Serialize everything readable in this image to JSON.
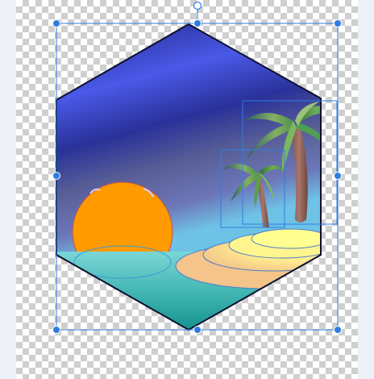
{
  "document": {
    "artwork": "tropical-sunset-hexagon",
    "selection": {
      "state": "selected",
      "handles": [
        "top-left",
        "top-center",
        "top-right",
        "middle-left",
        "middle-right",
        "bottom-left",
        "bottom-center",
        "bottom-right",
        "rotate"
      ]
    }
  },
  "colors": {
    "sky_top": "#1c2382",
    "sky_band": "#4a59e8",
    "sky_dusk": "#575e94",
    "horizon": "#6ec2e6",
    "sea_top": "#68d0d4",
    "sea_bottom": "#0f8f8a",
    "sun": "#ff9a00",
    "sand_light": "#ffff8a",
    "sand_dark": "#f6c88a",
    "palm_leaf": "#3c8a44",
    "palm_trunk": "#9e6a5e",
    "selection": "#2f7de1"
  }
}
